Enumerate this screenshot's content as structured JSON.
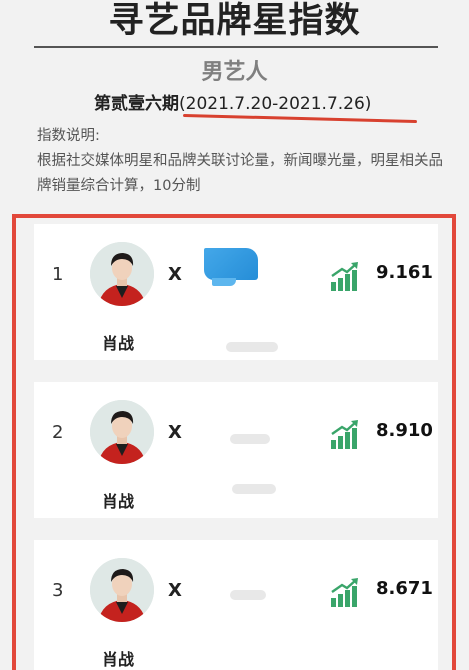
{
  "header": {
    "title": "寻艺品牌星指数",
    "category": "男艺人",
    "period_label": "第贰壹六期",
    "period_range": "(2021.7.20-2021.7.26)"
  },
  "description": {
    "heading": "指数说明:",
    "body": "根据社交媒体明星和品牌关联讨论量，新闻曝光量，明星相关品牌销量综合计算，10分制"
  },
  "ranking": [
    {
      "rank": "1",
      "name": "肖战",
      "cross": "X",
      "score": "9.161"
    },
    {
      "rank": "2",
      "name": "肖战",
      "cross": "X",
      "score": "8.910"
    },
    {
      "rank": "3",
      "name": "肖战",
      "cross": "X",
      "score": "8.671"
    }
  ],
  "colors": {
    "accent_red": "#e2483b",
    "trend_green": "#3aa56a",
    "background": "#f2f2f2",
    "card": "#ffffff"
  },
  "icons": {
    "trend": "trending-up-bar-chart-icon"
  }
}
